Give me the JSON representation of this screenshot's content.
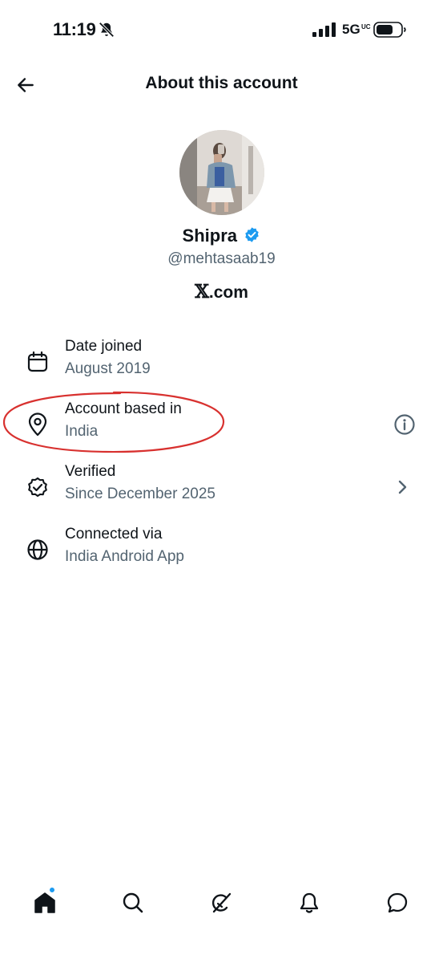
{
  "status_bar": {
    "time": "11:19",
    "network": "5G",
    "network_sub": "UC"
  },
  "header": {
    "title": "About this account"
  },
  "profile": {
    "display_name": "Shipra",
    "handle": "@mehtasaab19",
    "source_site_glyph": "𝕏",
    "source_site_suffix": ".com",
    "verified_badge_color": "#1d9bf0"
  },
  "rows": [
    {
      "icon": "calendar-icon",
      "title": "Date joined",
      "value": "August 2019",
      "trailing": ""
    },
    {
      "icon": "location-pin-icon",
      "title": "Account based in",
      "value": "India",
      "trailing": "info-icon"
    },
    {
      "icon": "verified-check-icon",
      "title": "Verified",
      "value": "Since December 2025",
      "trailing": "chevron-right-icon"
    },
    {
      "icon": "globe-icon",
      "title": "Connected via",
      "value": "India Android App",
      "trailing": ""
    }
  ],
  "annotation": {
    "color": "#d8312f",
    "shape": "hand-drawn ellipse around Account based in row"
  },
  "bottom_nav": {
    "items": [
      "home-icon",
      "search-icon",
      "grok-icon",
      "notifications-icon",
      "messages-icon"
    ],
    "active": "home-icon",
    "home_has_notification_dot": true
  },
  "colors": {
    "text_primary": "#0f1419",
    "text_secondary": "#536471",
    "accent": "#1d9bf0"
  }
}
